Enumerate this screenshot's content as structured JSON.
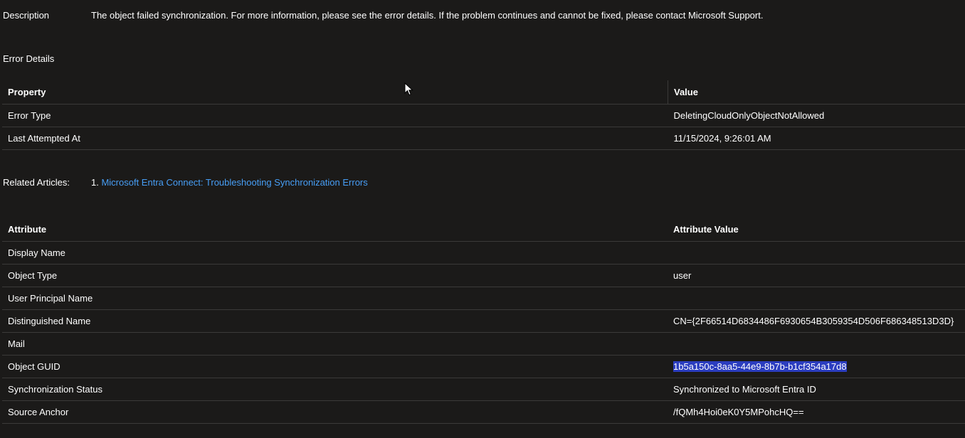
{
  "description": {
    "label": "Description",
    "text": "The object failed synchronization. For more information, please see the error details. If the problem continues and cannot be fixed, please contact Microsoft Support."
  },
  "error_details": {
    "title": "Error Details",
    "headers": [
      "Property",
      "Value"
    ],
    "rows": [
      [
        "Error Type",
        "DeletingCloudOnlyObjectNotAllowed"
      ],
      [
        "Last Attempted At",
        "11/15/2024, 9:26:01 AM"
      ]
    ]
  },
  "related": {
    "label": "Related Articles:",
    "index": "1.",
    "link_text": "Microsoft Entra Connect: Troubleshooting Synchronization Errors"
  },
  "attributes": {
    "headers": [
      "Attribute",
      "Attribute Value"
    ],
    "rows": [
      [
        "Display Name",
        ""
      ],
      [
        "Object Type",
        "user"
      ],
      [
        "User Principal Name",
        ""
      ],
      [
        "Distinguished Name",
        "CN={2F66514D6834486F6930654B3059354D506F686348513D3D}"
      ],
      [
        "Mail",
        ""
      ],
      [
        "Object GUID",
        "1b5a150c-8aa5-44e9-8b7b-b1cf354a17d8"
      ],
      [
        "Synchronization Status",
        "Synchronized to Microsoft Entra ID"
      ],
      [
        "Source Anchor",
        "/fQMh4Hoi0eK0Y5MPohcHQ=="
      ]
    ]
  },
  "colors": {
    "background": "#1b1a19",
    "link": "#479ef5",
    "selection": "#2b3dbf"
  }
}
